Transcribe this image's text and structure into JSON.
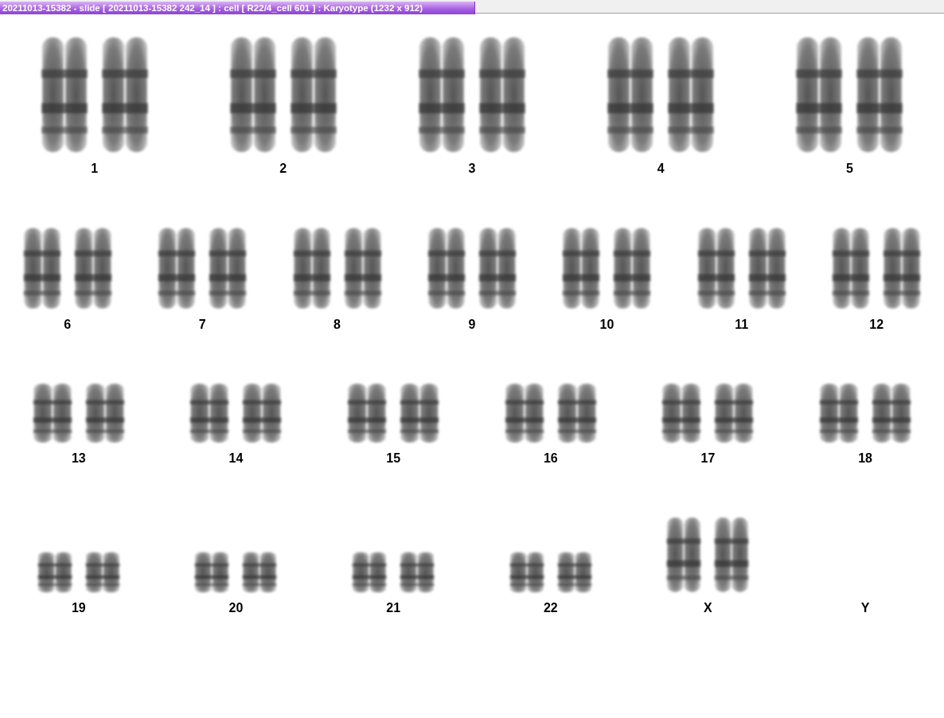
{
  "window": {
    "title": "20211013-15382 - slide [ 20211013-15382 242_14 ] : cell [ R22/4_cell 601 ] : Karyotype  (1232 x 912)"
  },
  "karyotype": {
    "rows": [
      {
        "pairs": [
          {
            "label": "1",
            "kind": "pair"
          },
          {
            "label": "2",
            "kind": "pair"
          },
          {
            "label": "3",
            "kind": "pair"
          },
          {
            "label": "4",
            "kind": "pair"
          },
          {
            "label": "5",
            "kind": "pair"
          }
        ]
      },
      {
        "pairs": [
          {
            "label": "6",
            "kind": "pair"
          },
          {
            "label": "7",
            "kind": "pair"
          },
          {
            "label": "8",
            "kind": "pair"
          },
          {
            "label": "9",
            "kind": "pair"
          },
          {
            "label": "10",
            "kind": "pair"
          },
          {
            "label": "11",
            "kind": "pair"
          },
          {
            "label": "12",
            "kind": "pair"
          }
        ]
      },
      {
        "pairs": [
          {
            "label": "13",
            "kind": "pair"
          },
          {
            "label": "14",
            "kind": "pair"
          },
          {
            "label": "15",
            "kind": "pair"
          },
          {
            "label": "16",
            "kind": "pair"
          },
          {
            "label": "17",
            "kind": "pair"
          },
          {
            "label": "18",
            "kind": "pair"
          }
        ]
      },
      {
        "pairs": [
          {
            "label": "19",
            "kind": "pair"
          },
          {
            "label": "20",
            "kind": "pair"
          },
          {
            "label": "21",
            "kind": "pair"
          },
          {
            "label": "22",
            "kind": "pair"
          },
          {
            "label": "X",
            "kind": "pair"
          },
          {
            "label": "Y",
            "kind": "empty"
          }
        ]
      }
    ]
  }
}
